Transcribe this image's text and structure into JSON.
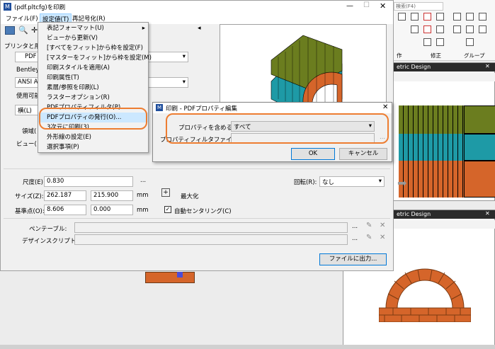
{
  "main_window": {
    "title": "(pdf.pltcfg)を印刷",
    "menu": {
      "file": "ファイル(F)",
      "settings": "設定値(T)",
      "regen": "再記号化(R)"
    },
    "printer_group": "プリンタと用紙",
    "printer_value": "PDF",
    "driver_label": "Bentley F",
    "paper_value": "ANSI A",
    "usable_label": "使用可能な",
    "orientation_value": "横(L)",
    "area_label": "領域(",
    "view_label": "ビュー(",
    "scale_label": "尺度(E):",
    "scale_value": "0.830",
    "size_label": "サイズ(Z):",
    "size_w": "262.187",
    "size_h": "215.900",
    "mm1": "mm",
    "maximize_label": "最大化",
    "origin_label": "基準点(O):",
    "origin_x": "8.606",
    "origin_y": "0.000",
    "mm2": "mm",
    "auto_center_label": "自動センタリング(C)",
    "rotation_label": "回転(R):",
    "rotation_value": "なし",
    "pen_table_label": "ペンテーブル:",
    "design_script_label": "デザインスクリプト:",
    "ellipsis": "...",
    "output_button": "ファイルに出力...",
    "panel_arrow": "◂"
  },
  "settings_menu": {
    "items": [
      {
        "label": "表記フォーマット(U)",
        "submenu": true
      },
      {
        "label": "ビューから更新(V)"
      },
      {
        "label": "[すべてをフィット]から枠を設定(F)"
      },
      {
        "label": "[マスターをフィット]から枠を設定(M)"
      },
      {
        "label": "印刷スタイルを適用(A)"
      },
      {
        "label": "印刷属性(T)"
      },
      {
        "label": "素層/参照を印刷(L)"
      },
      {
        "label": "ラスターオプション(R)"
      },
      {
        "label": "PDFプロパティフィルタ(P)"
      },
      {
        "label": "PDFプロパティの発行(O)..."
      },
      {
        "label": "3次元に印刷(3)"
      },
      {
        "label": "外形線の設定(E)"
      },
      {
        "label": "選択事項(P)"
      }
    ]
  },
  "pdf_dialog": {
    "title": "印刷 - PDFプロパティ編集",
    "include_label": "プロパティを含める:",
    "include_value": "すべて",
    "filter_label": "プロパティフィルタファイル:",
    "filter_browse": "...",
    "ok": "OK",
    "cancel": "キャンセル"
  },
  "background_app": {
    "search_text": "検索(F4)",
    "group_label1": "作",
    "group_label2": "修正",
    "group_label3": "グループ",
    "view1_title": "etric Design",
    "view2_title": "etric Design"
  },
  "colors": {
    "accent": "#ed7d31",
    "brick": "#d5652a",
    "olive": "#6b7d1f",
    "teal": "#1e9aa6",
    "viewbg": "#ffffff",
    "titlebar": "#2b2b2b"
  }
}
